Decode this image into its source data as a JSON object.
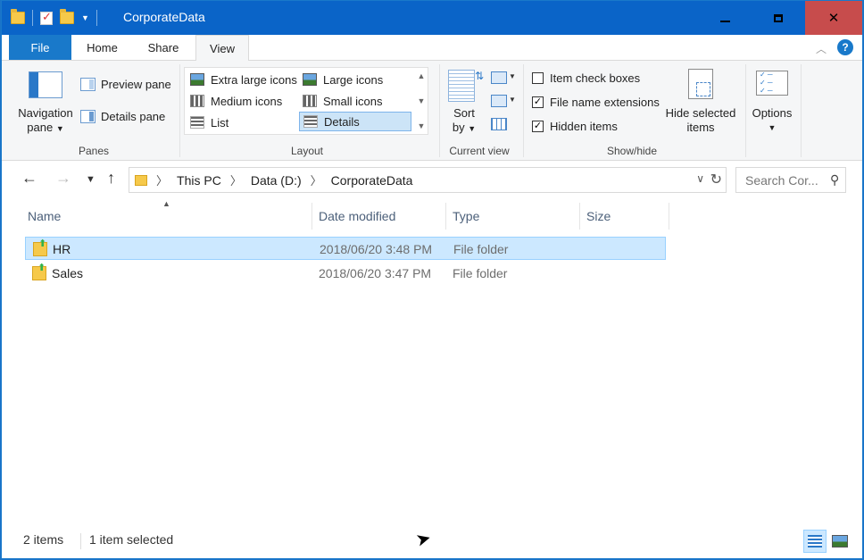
{
  "window": {
    "title": "CorporateData",
    "controls": {
      "minimize": "minimize",
      "maximize": "maximize",
      "close": "close"
    }
  },
  "ribbon_tabs": [
    "File",
    "Home",
    "Share",
    "View"
  ],
  "active_tab": "View",
  "ribbon": {
    "panes": {
      "navigation_pane_line1": "Navigation",
      "navigation_pane_line2": "pane",
      "preview_pane": "Preview pane",
      "details_pane": "Details pane",
      "group_label": "Panes"
    },
    "layout": {
      "options": [
        "Extra large icons",
        "Large icons",
        "Medium icons",
        "Small icons",
        "List",
        "Details"
      ],
      "selected": "Details",
      "group_label": "Layout"
    },
    "current_view": {
      "sort_by_line1": "Sort",
      "sort_by_line2": "by",
      "group_label": "Current view"
    },
    "show_hide": {
      "item_check_boxes": {
        "label": "Item check boxes",
        "checked": false
      },
      "file_name_extensions": {
        "label": "File name extensions",
        "checked": true
      },
      "hidden_items": {
        "label": "Hidden items",
        "checked": true
      },
      "hide_selected_line1": "Hide selected",
      "hide_selected_line2": "items",
      "group_label": "Show/hide"
    },
    "options": {
      "label": "Options"
    }
  },
  "address_bar": {
    "crumbs": [
      "This PC",
      "Data (D:)",
      "CorporateData"
    ],
    "search_placeholder": "Search Cor..."
  },
  "columns": [
    "Name",
    "Date modified",
    "Type",
    "Size"
  ],
  "files": [
    {
      "name": "HR",
      "date_modified": "2018/06/20 3:48 PM",
      "type": "File folder",
      "size": "",
      "selected": true
    },
    {
      "name": "Sales",
      "date_modified": "2018/06/20 3:47 PM",
      "type": "File folder",
      "size": "",
      "selected": false
    }
  ],
  "status": {
    "item_count": "2 items",
    "selection": "1 item selected"
  },
  "colors": {
    "title_bar": "#0a64c8",
    "close_button": "#c74c4c",
    "selection": "#cce8ff",
    "file_tab": "#1979ca"
  }
}
